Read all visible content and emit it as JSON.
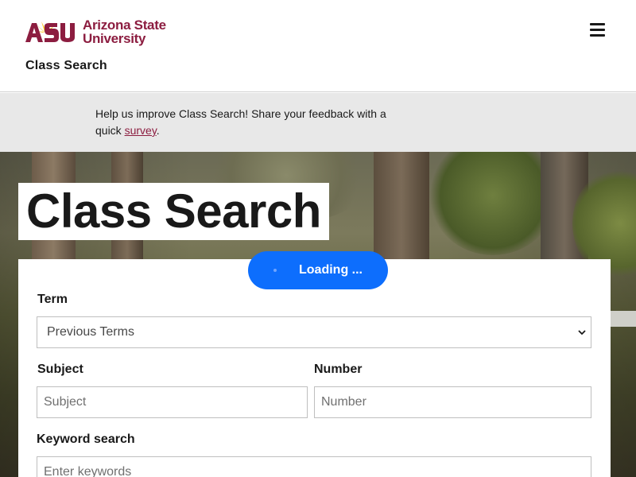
{
  "header": {
    "logo_line1": "Arizona State",
    "logo_line2": "University",
    "logo_mark": "ASU",
    "site_title": "Class Search",
    "menu_icon": "hamburger-menu-icon"
  },
  "banner": {
    "text_before": "Help us improve Class Search! Share your feedback with a quick ",
    "link_text": "survey",
    "text_after": "."
  },
  "hero": {
    "title": "Class Search"
  },
  "loading": {
    "label": "Loading ..."
  },
  "form": {
    "term_label": "Term",
    "term_value": "Previous Terms",
    "subject_label": "Subject",
    "subject_placeholder": "Subject",
    "number_label": "Number",
    "number_placeholder": "Number",
    "keyword_label": "Keyword search",
    "keyword_placeholder": "Enter keywords"
  },
  "colors": {
    "brand_maroon": "#8c1d40",
    "brand_gold": "#ffc627",
    "loading_blue": "#0d6efd"
  }
}
